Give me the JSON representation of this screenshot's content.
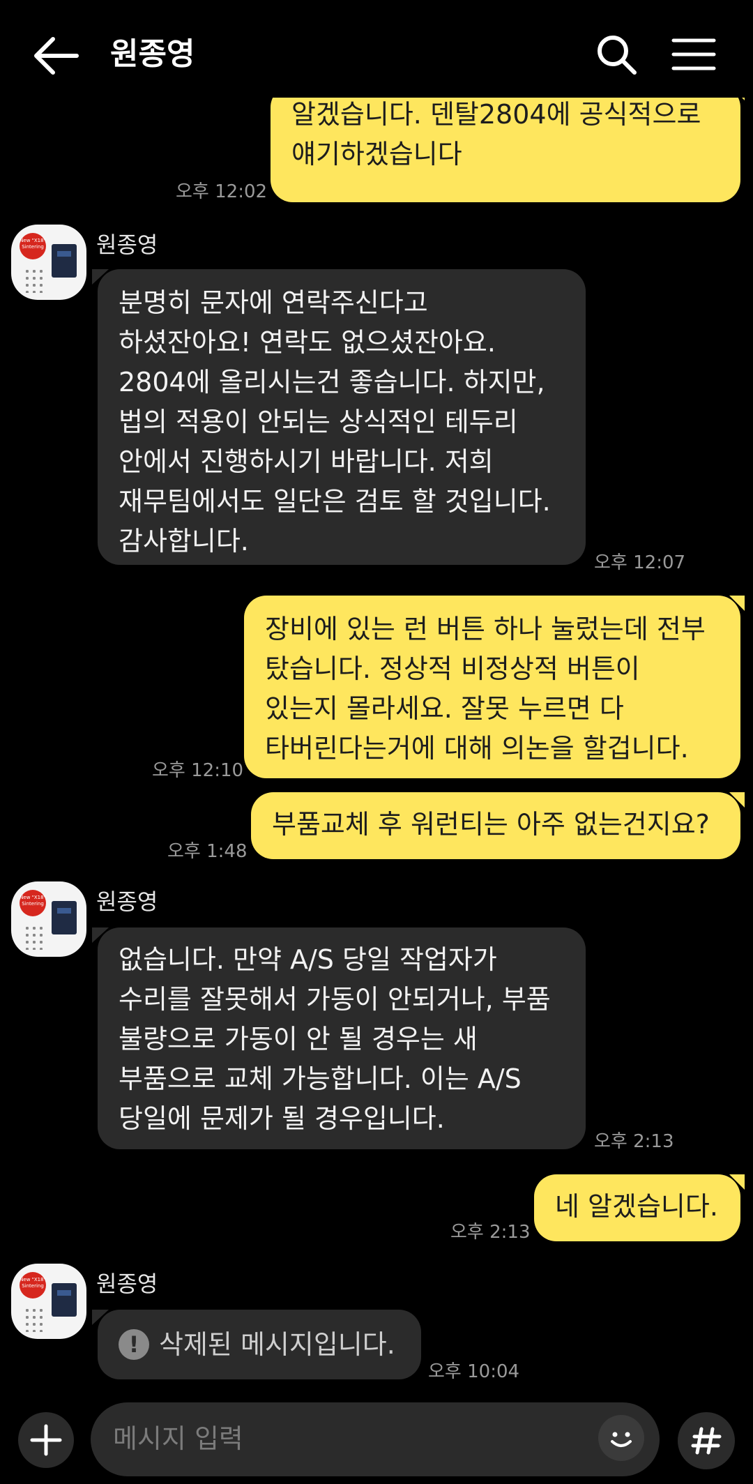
{
  "header": {
    "title": "원종영"
  },
  "messages": [
    {
      "text": "알겠습니다. 덴탈2804에 공식적으로\n얘기하겠습니다",
      "time": "오후 12:02"
    },
    {
      "sender": "원종영",
      "text": "분명히 문자에 연락주신다고\n하셨잔아요! 연락도 없으셨잔아요.\n2804에 올리시는건 좋습니다. 하지만,\n법의 적용이 안되는 상식적인 테두리\n안에서 진행하시기 바랍니다. 저희\n재무팀에서도 일단은 검토 할 것입니다.\n감사합니다.",
      "time": "오후 12:07"
    },
    {
      "text": "장비에 있는 런 버튼 하나 눌렀는데 전부\n탔습니다. 정상적 비정상적 버튼이\n있는지 몰라세요. 잘못 누르면 다\n타버린다는거에 대해 의논을 할겁니다.",
      "time": "오후 12:10"
    },
    {
      "text": "부품교체 후 워런티는 아주 없는건지요?",
      "time": "오후 1:48"
    },
    {
      "sender": "원종영",
      "text": "없습니다. 만약 A/S 당일 작업자가\n수리를 잘못해서 가동이 안되거나, 부품\n불량으로 가동이 안 될 경우는 새\n부품으로 교체 가능합니다. 이는 A/S\n당일에 문제가 될 경우입니다.",
      "time": "오후 2:13"
    },
    {
      "text": "네 알겠습니다.",
      "time": "오후 2:13"
    },
    {
      "sender": "원종영",
      "text": "삭제된 메시지입니다.",
      "time": "오후 10:04"
    }
  ],
  "avatar": {
    "logo_text": "New \"X18\" Sintering"
  },
  "input": {
    "placeholder": "메시지 입력"
  },
  "icons": {
    "back": "arrow-left-icon",
    "search": "search-icon",
    "menu": "menu-icon",
    "plus": "plus-icon",
    "emoji": "emoji-icon",
    "hash": "hash-icon",
    "warning": "warning-icon"
  },
  "colors": {
    "outgoing_bubble": "#FEE65E",
    "incoming_bubble": "#2b2b2b",
    "background": "#000000"
  }
}
